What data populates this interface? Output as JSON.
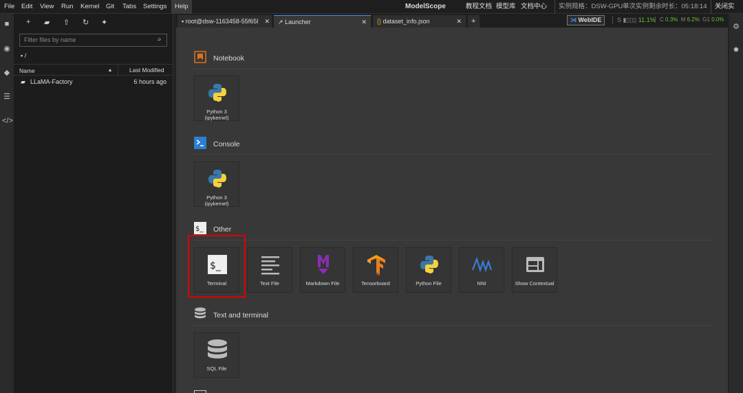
{
  "menu": [
    "File",
    "Edit",
    "View",
    "Run",
    "Kernel",
    "Git",
    "Tabs",
    "Settings",
    "Help"
  ],
  "topbar": {
    "brand": "ModelScope",
    "links": [
      "教程文档",
      "模型库",
      "文档中心"
    ],
    "spec": "实例规格：DSW-GPU",
    "remaining": "单次实例剩余时长：05:18:14",
    "close": "关闭实例"
  },
  "filebrowser": {
    "filter_placeholder": "Filter files by name",
    "path": "/",
    "col_name": "Name",
    "col_modified": "Last Modified",
    "rows": [
      {
        "name": "LLaMA-Factory",
        "modified": "6 hours ago"
      }
    ]
  },
  "tabs": [
    {
      "label": "root@dsw-1163458-55f65l"
    },
    {
      "label": "Launcher"
    },
    {
      "label": "dataset_info.json"
    }
  ],
  "status": {
    "webide": "WebIDE",
    "s_label": "S",
    "s_val": "11.1%",
    "c_label": "C",
    "c_val": "0.3%",
    "m_label": "M",
    "m_val": "6.2%",
    "g_label": "G1",
    "g_val": "0.0%",
    "accent": "#6bbf3b"
  },
  "launcher": {
    "notebook": {
      "title": "Notebook",
      "cards": [
        {
          "label": "Python 3 (ipykernel)"
        }
      ]
    },
    "console": {
      "title": "Console",
      "cards": [
        {
          "label": "Python 3 (ipykernel)"
        }
      ]
    },
    "other": {
      "title": "Other",
      "cards": [
        {
          "label": "Terminal",
          "icon": "terminal-icon"
        },
        {
          "label": "Text File",
          "icon": "text-file-icon"
        },
        {
          "label": "Markdown File",
          "icon": "markdown-icon"
        },
        {
          "label": "Tensorboard",
          "icon": "tensorflow-icon"
        },
        {
          "label": "Python File",
          "icon": "python-icon"
        },
        {
          "label": "NNI",
          "icon": "nni-icon"
        },
        {
          "label": "Show Contextual",
          "icon": "contextual-help-icon"
        }
      ]
    },
    "textterm": {
      "title": "Text and terminal",
      "cards": [
        {
          "label": "SQL File"
        }
      ]
    }
  },
  "highlight_color": "#e00000"
}
